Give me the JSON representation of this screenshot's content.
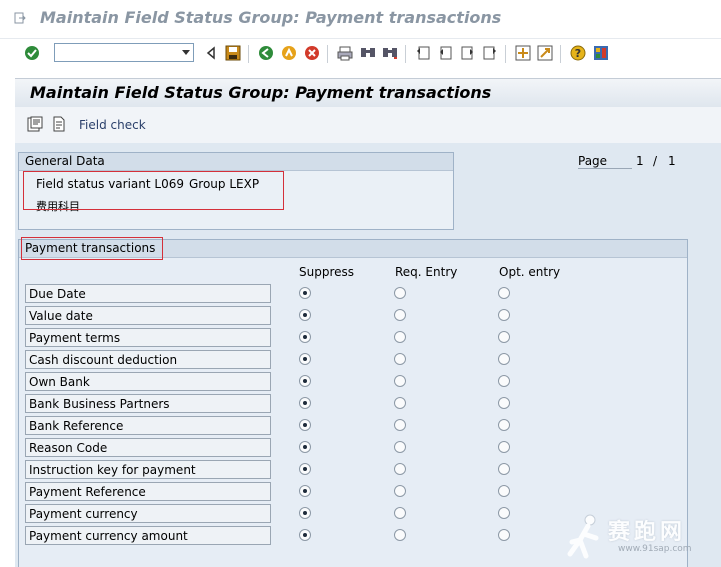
{
  "window": {
    "title": "Maintain Field Status Group: Payment transactions"
  },
  "toolbar": {
    "command_field_value": "",
    "icons": [
      "enter-icon",
      "save-icon",
      "back-icon",
      "exit-icon",
      "cancel-icon",
      "print-icon",
      "find-icon",
      "find-next-icon",
      "first-page-icon",
      "previous-page-icon",
      "next-page-icon",
      "last-page-icon",
      "create-session-icon",
      "shortcut-icon",
      "help-icon",
      "layout-icon"
    ]
  },
  "screen": {
    "header": "Maintain Field Status Group: Payment transactions",
    "app_toolbar": {
      "field_check_label": "Field check"
    },
    "page": {
      "label": "Page",
      "current": "1",
      "separator": "/",
      "total": "1"
    },
    "general_data": {
      "title": "General Data",
      "variant_text": "Field status variant L069",
      "group_text": "Group LEXP",
      "description": "费用科目"
    },
    "payment": {
      "title": "Payment transactions",
      "columns": [
        "Suppress",
        "Req. Entry",
        "Opt. entry"
      ],
      "rows": [
        {
          "label": "Due Date",
          "selected": "suppress"
        },
        {
          "label": "Value date",
          "selected": "suppress"
        },
        {
          "label": "Payment terms",
          "selected": "suppress"
        },
        {
          "label": "Cash discount deduction",
          "selected": "suppress"
        },
        {
          "label": "Own Bank",
          "selected": "suppress"
        },
        {
          "label": "Bank Business Partners",
          "selected": "suppress"
        },
        {
          "label": "Bank Reference",
          "selected": "suppress"
        },
        {
          "label": "Reason Code",
          "selected": "suppress"
        },
        {
          "label": "Instruction key for payment",
          "selected": "suppress"
        },
        {
          "label": "Payment Reference",
          "selected": "suppress"
        },
        {
          "label": "Payment currency",
          "selected": "suppress"
        },
        {
          "label": "Payment currency amount",
          "selected": "suppress"
        }
      ]
    }
  },
  "watermark": {
    "text": "赛跑网",
    "url": "www.91sap.com"
  },
  "colors": {
    "highlight_box": "#d4303a",
    "work_area": "#dfe8f1",
    "group_header": "#d2dde9"
  }
}
